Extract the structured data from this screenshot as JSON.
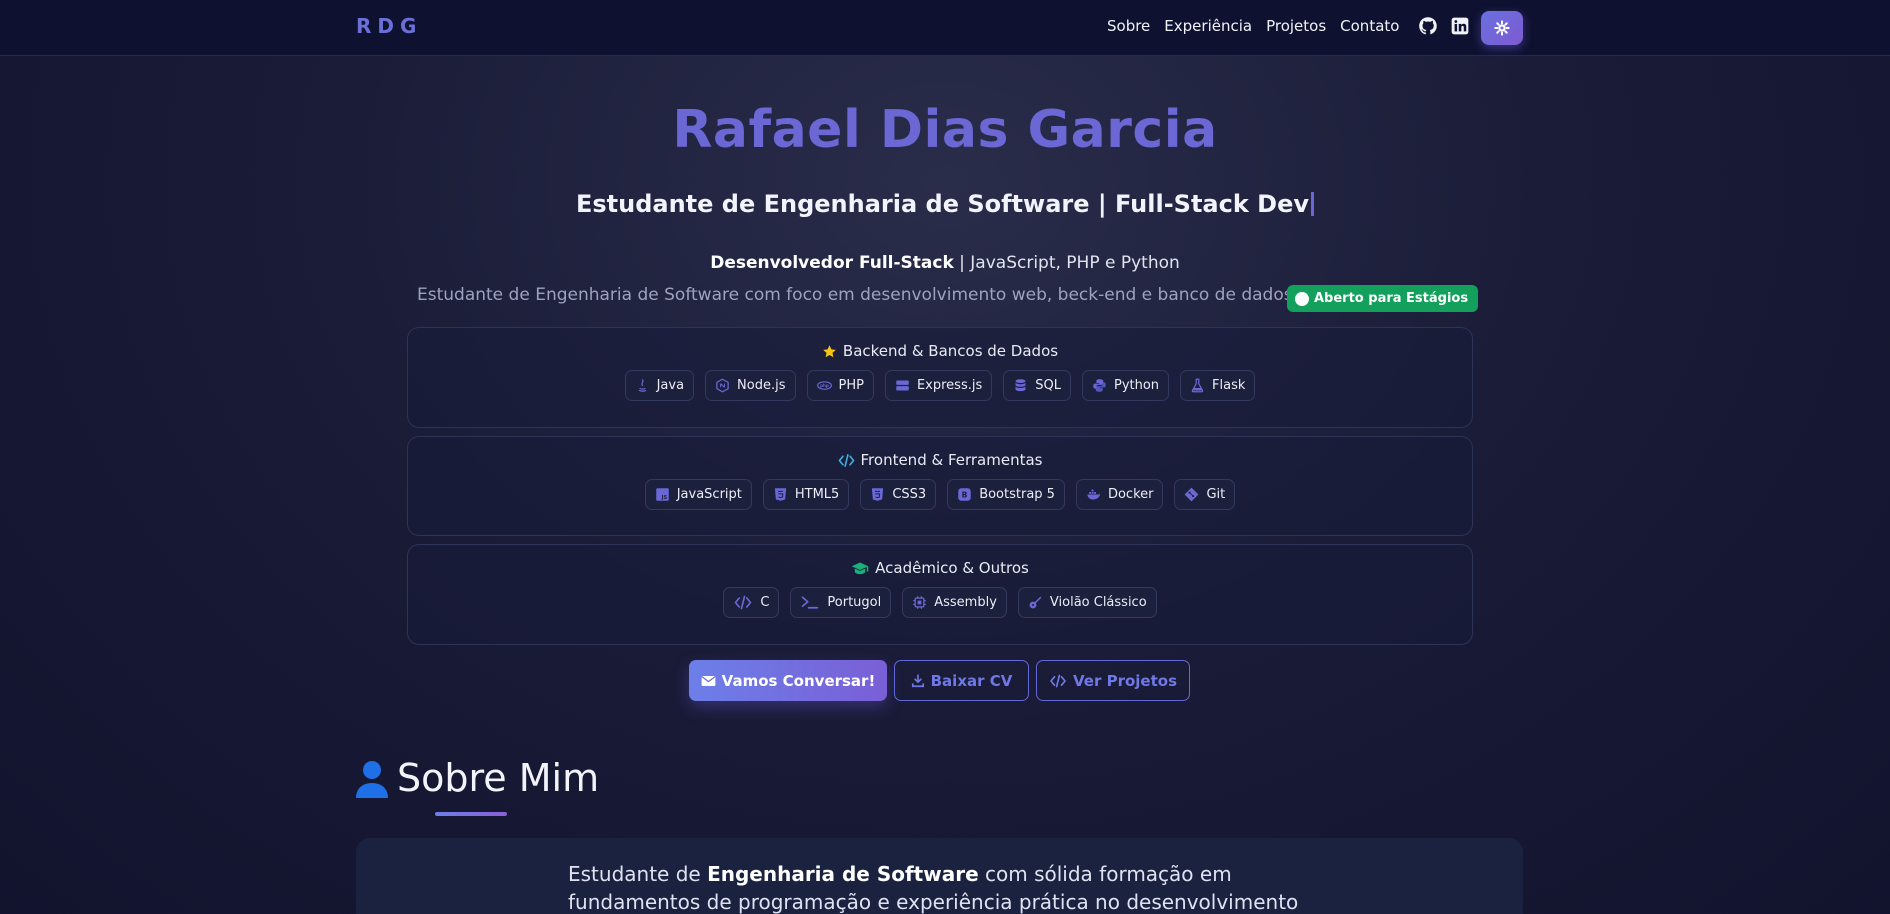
{
  "nav": {
    "brand": "RDG",
    "links": [
      "Sobre",
      "Experiência",
      "Projetos",
      "Contato"
    ],
    "icons": [
      "github-icon",
      "linkedin-icon",
      "gear-icon"
    ]
  },
  "hero": {
    "name": "Rafael Dias Garcia",
    "subtitle": "Estudante de Engenharia de Software | Full-Stack Dev",
    "role_bold": "Desenvolvedor Full-Stack",
    "role_rest": " | JavaScript, PHP e Python",
    "description": "Estudante de Engenharia de Software com foco em desenvolvimento web, beck-end e banco de dados",
    "badge": "Aberto para Estágios"
  },
  "skills": [
    {
      "title": "Backend & Bancos de Dados",
      "icon": "star-icon",
      "items": [
        "Java",
        "Node.js",
        "PHP",
        "Express.js",
        "SQL",
        "Python",
        "Flask"
      ]
    },
    {
      "title": "Frontend & Ferramentas",
      "icon": "code-icon",
      "items": [
        "JavaScript",
        "HTML5",
        "CSS3",
        "Bootstrap 5",
        "Docker",
        "Git"
      ]
    },
    {
      "title": "Acadêmico & Outros",
      "icon": "graduation-cap-icon",
      "items": [
        "C",
        "Portugol",
        "Assembly",
        "Violão Clássico"
      ]
    }
  ],
  "buttons": {
    "primary": "Vamos Conversar!",
    "cv": "Baixar CV",
    "projects": "Ver Projetos"
  },
  "about": {
    "title": "Sobre Mim",
    "text_1": "Estudante de ",
    "text_bold": "Engenharia de Software",
    "text_2": " com sólida formação em fundamentos de programação e experiência prática no desenvolvimento de aplicações web"
  },
  "colors": {
    "accent": "#6b68d6",
    "badge_green": "#12a05c",
    "background": "#1a1c38"
  }
}
